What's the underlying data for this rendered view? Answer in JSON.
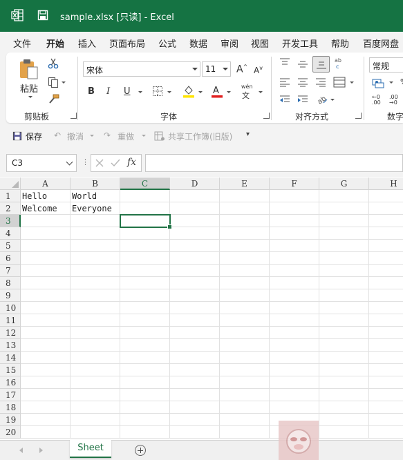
{
  "titlebar": {
    "title": "sample.xlsx  [只读]  -  Excel",
    "bg_color": "#157343"
  },
  "menu": {
    "tabs": [
      "文件",
      "开始",
      "插入",
      "页面布局",
      "公式",
      "数据",
      "审阅",
      "视图",
      "开发工具",
      "帮助",
      "百度网盘"
    ],
    "active": "开始"
  },
  "ribbon": {
    "clipboard": {
      "paste_label": "粘贴",
      "group_label": "剪贴板"
    },
    "font": {
      "font_name": "宋体",
      "font_size": "11",
      "bold": "B",
      "italic": "I",
      "underline": "U",
      "group_label": "字体",
      "phonetic": "wén"
    },
    "alignment": {
      "group_label": "对齐方式"
    },
    "number": {
      "format": "常规",
      "group_label": "数字"
    }
  },
  "qat": {
    "save": "保存",
    "undo": "撤消",
    "redo": "重做",
    "share": "共享工作簿(旧版)"
  },
  "formula_bar": {
    "name_box": "C3",
    "fx": "fx",
    "value": ""
  },
  "sheet": {
    "columns": [
      "A",
      "B",
      "C",
      "D",
      "E",
      "F",
      "G",
      "H"
    ],
    "rows": [
      "1",
      "2",
      "3",
      "4",
      "5",
      "6",
      "7",
      "8",
      "9",
      "10",
      "11",
      "12",
      "13",
      "14",
      "15",
      "16",
      "17",
      "18",
      "19",
      "20"
    ],
    "selected_column": "C",
    "selected_row": "3",
    "cells": {
      "A1": "Hello",
      "B1": "World",
      "A2": "Welcome",
      "B2": "Everyone"
    },
    "accent_color": "#217346"
  },
  "sheet_tabs": {
    "active_tab": "Sheet"
  }
}
